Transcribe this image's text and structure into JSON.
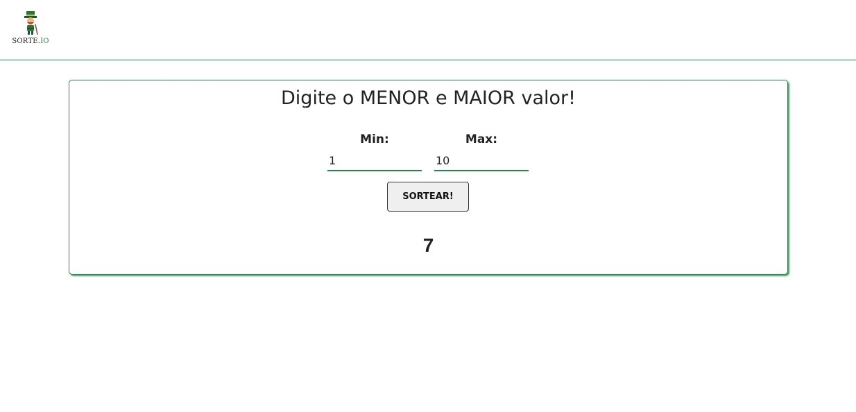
{
  "header": {
    "logo_text_main": "SORTE.",
    "logo_text_accent": "IO",
    "logo_icon": "leprechaun-icon"
  },
  "card": {
    "title": "Digite o MENOR e MAIOR valor!",
    "min_label": "Min:",
    "min_value": "1",
    "max_label": "Max:",
    "max_value": "10",
    "button_label": "SORTEAR!",
    "result": "7"
  },
  "colors": {
    "accent": "#1f8a4c",
    "text": "#222222",
    "button_bg": "#efefef"
  }
}
